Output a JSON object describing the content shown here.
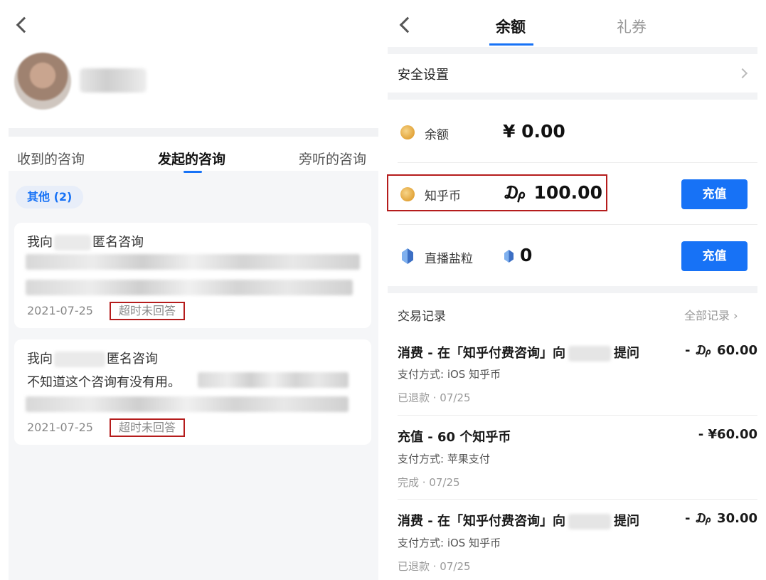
{
  "left": {
    "tabs": [
      "收到的咨询",
      "发起的咨询",
      "旁听的咨询"
    ],
    "filter_chip": "其他 (2)",
    "cards": [
      {
        "title_prefix": "我向",
        "title_suffix": "匿名咨询",
        "text": "",
        "date": "2021-07-25",
        "status": "超时未回答"
      },
      {
        "title_prefix": "我向",
        "title_suffix": "匿名咨询",
        "text": "不知道这个咨询有没有用。",
        "date": "2021-07-25",
        "status": "超时未回答"
      }
    ]
  },
  "right": {
    "tabs": [
      "余额",
      "礼券"
    ],
    "security_settings": "安全设置",
    "assets": [
      {
        "label": "余额",
        "value": "¥ 0.00"
      },
      {
        "label": "知乎币",
        "value": "₯ 100.00",
        "button": "充值"
      },
      {
        "label": "直播盐粒",
        "value": "0",
        "button": "充值"
      }
    ],
    "transactions_header": "交易记录",
    "all_records": "全部记录 ›",
    "transactions": [
      {
        "title_prefix": "消费 - 在「知乎付费咨询」向",
        "title_suffix": "提问",
        "amount": "- ₯ 60.00",
        "method": "支付方式: iOS 知乎币",
        "status": "已退款 · 07/25"
      },
      {
        "title_prefix": "充值 - 60 个知乎币",
        "title_suffix": "",
        "amount": "- ¥60.00",
        "method": "支付方式: 苹果支付",
        "status": "完成 · 07/25"
      },
      {
        "title_prefix": "消费 - 在「知乎付费咨询」向",
        "title_suffix": "提问",
        "amount": "- ₯ 30.00",
        "method": "支付方式: iOS 知乎币",
        "status": "已退款 · 07/25"
      }
    ]
  },
  "colors": {
    "accent": "#1772f6",
    "highlight_border": "#b51c1c"
  },
  "icons": [
    "back-chevron-icon",
    "coin-icon",
    "salt-grain-icon",
    "chevron-right-icon"
  ]
}
